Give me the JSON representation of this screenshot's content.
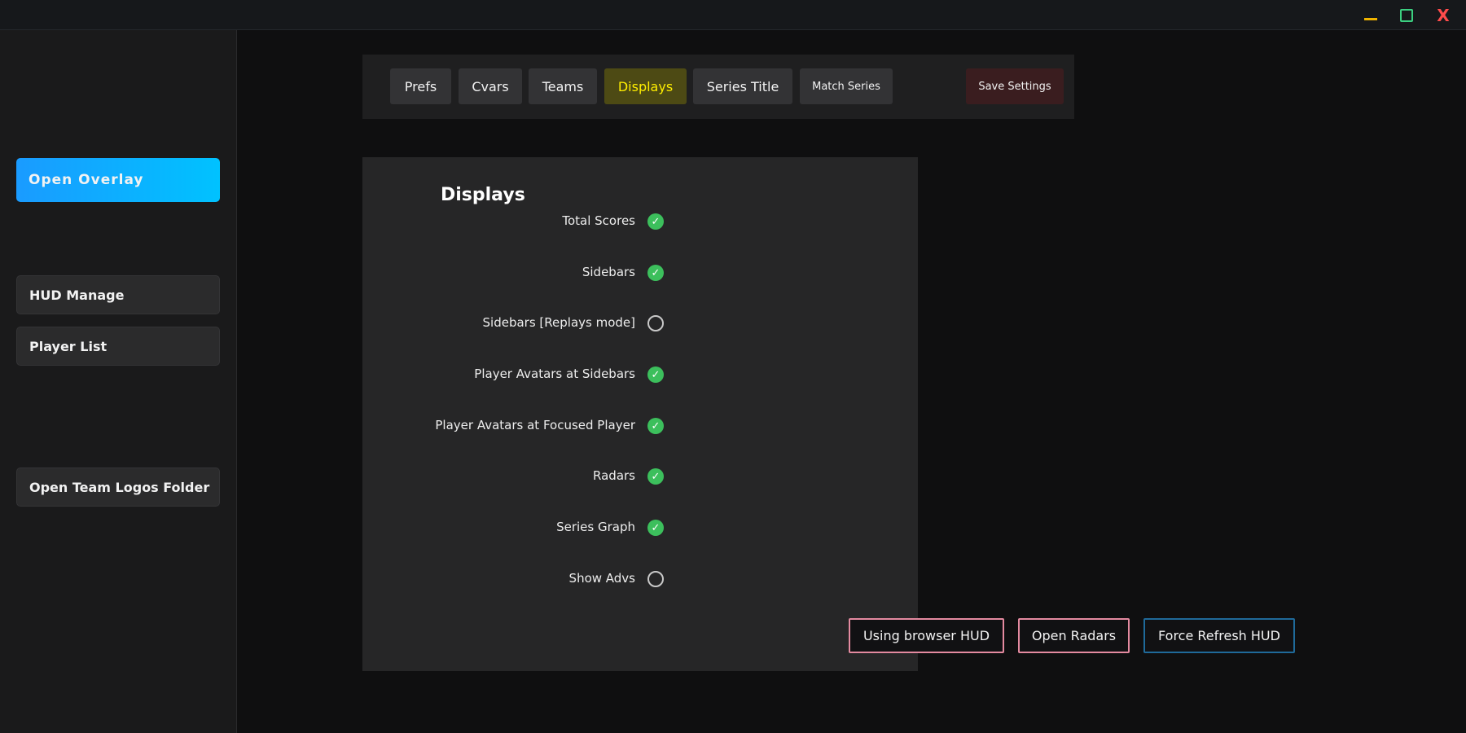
{
  "window": {
    "minimize_label": "",
    "maximize_label": "",
    "close_label": "X"
  },
  "sidebar": {
    "open_overlay": "Open Overlay",
    "hud_manage": "HUD Manage",
    "player_list": "Player List",
    "open_team_logos": "Open Team Logos Folder"
  },
  "tabs": {
    "prefs": "Prefs",
    "cvars": "Cvars",
    "teams": "Teams",
    "displays": "Displays",
    "series_title": "Series Title",
    "match_series": "Match Series",
    "save_settings": "Save Settings",
    "active": "Displays"
  },
  "panel": {
    "title": "Displays",
    "options": [
      {
        "label": "Total Scores",
        "checked": true
      },
      {
        "label": "Sidebars",
        "checked": true
      },
      {
        "label": "Sidebars [Replays mode]",
        "checked": false
      },
      {
        "label": "Player Avatars at Sidebars",
        "checked": true
      },
      {
        "label": "Player Avatars at Focused Player",
        "checked": true
      },
      {
        "label": "Radars",
        "checked": true
      },
      {
        "label": "Series Graph",
        "checked": true
      },
      {
        "label": "Show Advs",
        "checked": false
      }
    ]
  },
  "actions": {
    "using_browser_hud": "Using browser HUD",
    "open_radars": "Open Radars",
    "force_refresh_hud": "Force Refresh HUD"
  },
  "colors": {
    "accent": "#00c2ff",
    "active_tab_text": "#ffee00",
    "check_green": "#3cbf5c",
    "pink_border": "#e48aa0",
    "blue_border": "#1f6a9a"
  }
}
